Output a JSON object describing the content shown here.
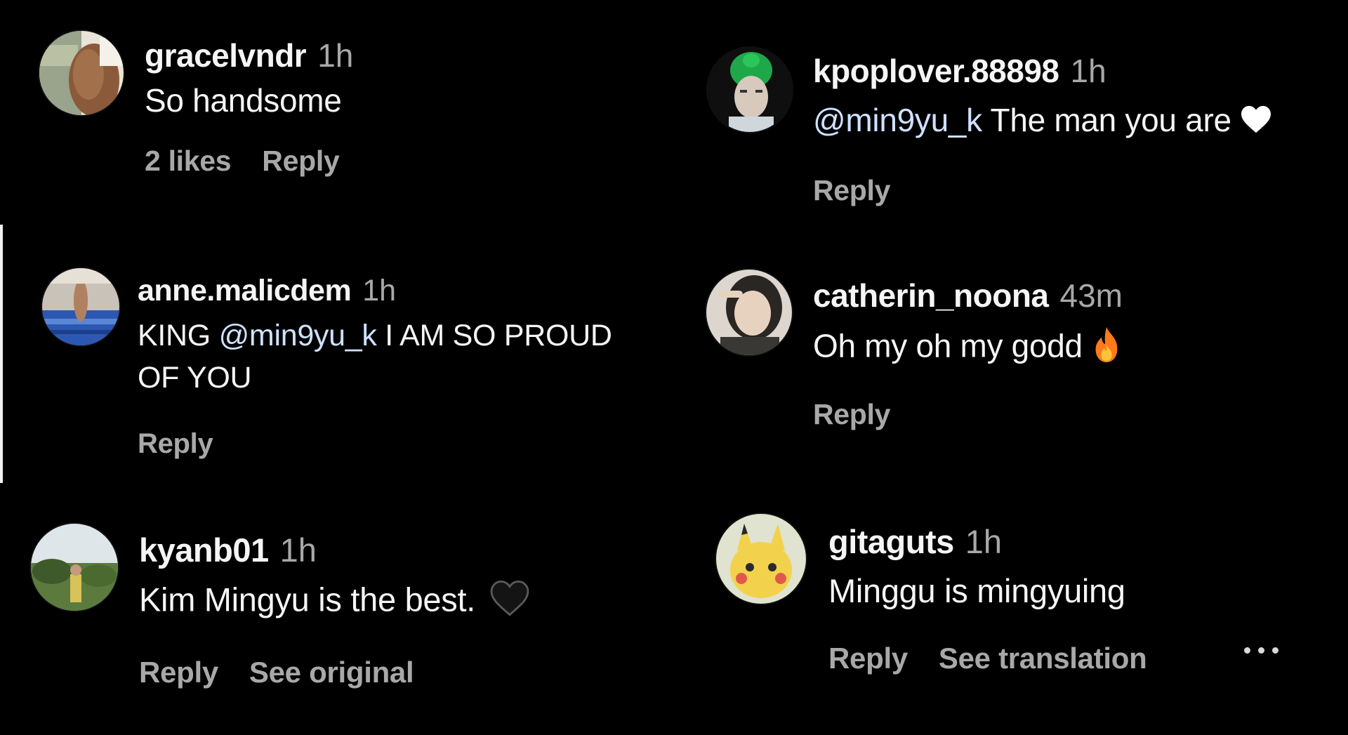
{
  "actions": {
    "reply": "Reply",
    "see_original": "See original",
    "see_translation": "See translation"
  },
  "comments": [
    {
      "username": "gracelvndr",
      "time": "1h",
      "text": "So handsome",
      "likes": "2 likes"
    },
    {
      "username": "kpoplover.88898",
      "time": "1h",
      "mention": "@min9yu_k",
      "text": " The man you are",
      "emoji": "white-heart-icon"
    },
    {
      "username": "anne.malicdem",
      "time": "1h",
      "text_before": "KING ",
      "mention": "@min9yu_k",
      "text_after": " I AM SO PROUD",
      "text_line2": "OF YOU"
    },
    {
      "username": "catherin_noona",
      "time": "43m",
      "text": "Oh my oh my godd",
      "emoji": "fire-icon"
    },
    {
      "username": "kyanb01",
      "time": "1h",
      "text": "Kim Mingyu is the best.",
      "emoji": "black-heart-icon"
    },
    {
      "username": "gitaguts",
      "time": "1h",
      "text": "Minggu is mingyuing"
    }
  ],
  "colors": {
    "background": "#000000",
    "text": "#f5f5f5",
    "secondary": "#a8a8a8",
    "mention": "#cfe1ff",
    "fire": "#ff7a1a"
  }
}
